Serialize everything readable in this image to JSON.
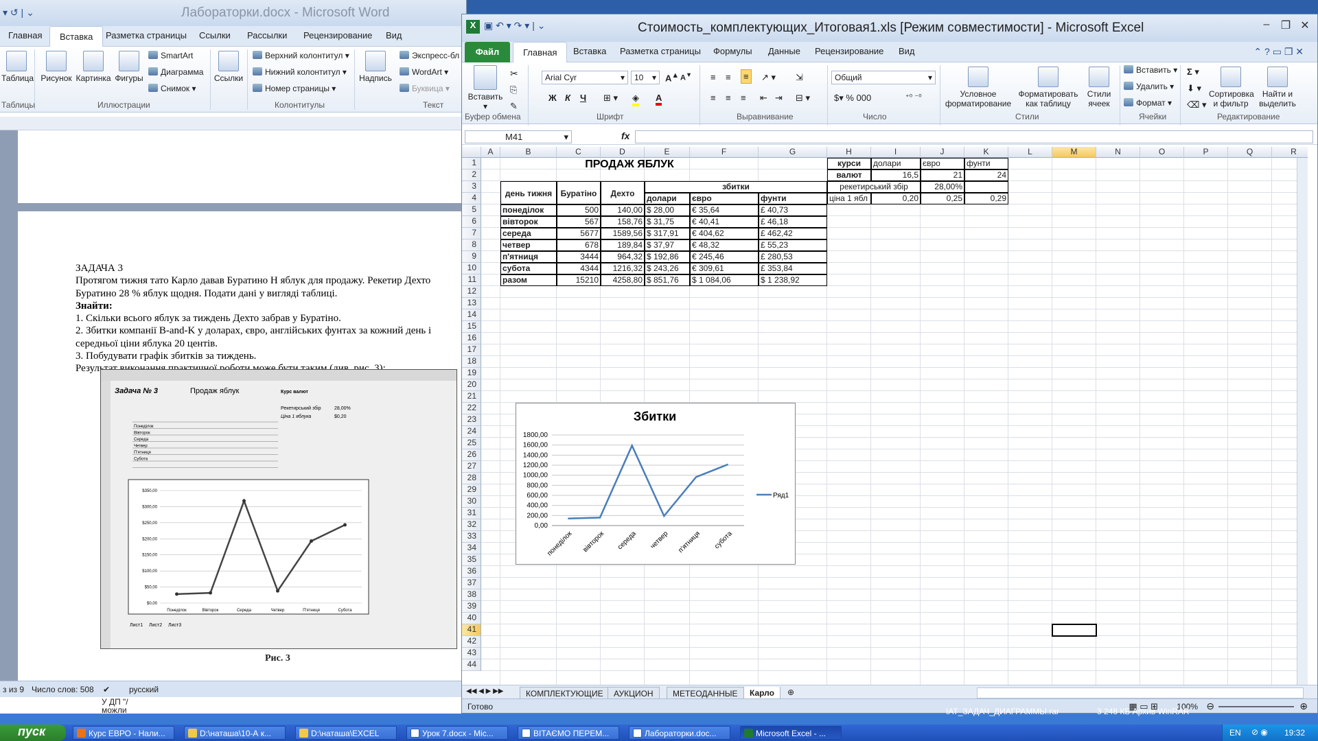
{
  "word": {
    "title": "Лабораторки.docx  -  Microsoft Word",
    "tabs": [
      "Главная",
      "Вставка",
      "Разметка страницы",
      "Ссылки",
      "Рассылки",
      "Рецензирование",
      "Вид"
    ],
    "active_tab": "Вставка",
    "ribbon": {
      "table": "Таблица",
      "picture": "Рисунок",
      "clipart": "Картинка",
      "shapes": "Фигуры",
      "smartart": "SmartArt",
      "chart": "Диаграмма",
      "snapshot": "Снимок",
      "links": "Ссылки",
      "header": "Верхний колонтитул",
      "footer": "Нижний колонтитул",
      "page_number": "Номер страницы",
      "textbox": "Надпись",
      "express": "Экспресс-бл",
      "wordart": "WordArt",
      "dropcap": "Буквица",
      "groups": [
        "Таблицы",
        "Иллюстрации",
        "Колонтитулы",
        "Текст"
      ]
    },
    "doc": {
      "heading": "ЗАДАЧА 3",
      "p1": "Протягом тижня тато Карло давав Буратино Н яблук для продажу. Рекетир Дехто",
      "p1b": "Буратино 28 % яблук щодня. Подати дані у вигляді таблиці.",
      "find": "Знайти:",
      "l1": "1. Скільки всього яблук за тиждень Дехто забрав у Буратіно.",
      "l2": "2. Збитки компанії B-and-K у доларах, євро, англійських фунтах за кожний день і",
      "l2b": "середньої ціни яблука 20 центів.",
      "l3": "3. Побудувати графік збитків за тиждень.",
      "l4": "Результат виконання практичної роботи може бути таким (див. рис. 3):",
      "caption": "Рис. 3",
      "fig": {
        "title1": "Задача № 3",
        "title2": "Продаж яблук",
        "kurs": "Курс валют",
        "reket": "Рекетирський збір",
        "reket_val": "28,00%",
        "price": "Ціна 1 яблука",
        "price_val": "$0,20",
        "days": [
          "Понеділок",
          "Вівторок",
          "Середа",
          "Четвер",
          "П'ятниця",
          "Субота"
        ],
        "yticks": [
          "$0,00",
          "$50,00",
          "$100,00",
          "$150,00",
          "$200,00",
          "$250,00",
          "$300,00",
          "$350,00"
        ],
        "values": [
          28,
          31.75,
          317.91,
          37.97,
          192.86,
          243.26
        ],
        "sheets": [
          "Лист1",
          "Лист2",
          "Лист3"
        ]
      }
    },
    "status": {
      "page": "з из 9",
      "words": "Число слов: 508",
      "lang": "русский"
    },
    "below1": "У ДП \"/",
    "below2": "можли"
  },
  "excel": {
    "title": "Стоимость_комплектующих_Итоговая1.xls  [Режим совместимости]  -  Microsoft Excel",
    "file_tab": "Файл",
    "tabs": [
      "Главная",
      "Вставка",
      "Разметка страницы",
      "Формулы",
      "Данные",
      "Рецензирование",
      "Вид"
    ],
    "active_tab": "Главная",
    "ribbon": {
      "paste": "Вставить",
      "font_name": "Arial Cyr",
      "font_size": "10",
      "number_format": "Общий",
      "cond_format": "Условное форматирование",
      "format_table": "Форматировать как таблицу",
      "cell_styles": "Стили ячеек",
      "insert": "Вставить",
      "delete": "Удалить",
      "format": "Формат",
      "sort": "Сортировка и фильтр",
      "find": "Найти и выделить",
      "groups": [
        "Буфер обмена",
        "Шрифт",
        "Выравнивание",
        "Число",
        "Стили",
        "Ячейки",
        "Редактирование"
      ]
    },
    "name_box": "M41",
    "fx": "fx",
    "columns": [
      "A",
      "B",
      "C",
      "D",
      "E",
      "F",
      "G",
      "H",
      "I",
      "J",
      "K",
      "L",
      "M",
      "N",
      "O",
      "P",
      "Q",
      "R"
    ],
    "sheet": {
      "title": "ПРОДАЖ ЯБЛУК",
      "header_day": "день тижня",
      "header_buratino": "Буратіно",
      "header_dehto": "Дехто",
      "header_losses": "збитки",
      "header_usd": "долари",
      "header_eur": "євро",
      "header_gbp": "фунти",
      "rows": [
        {
          "day": "понеділок",
          "b": "500",
          "d": "140,00",
          "usd": "$   28,00",
          "eur": "€          35,64",
          "gbp": "£          40,73"
        },
        {
          "day": "вівторок",
          "b": "567",
          "d": "158,76",
          "usd": "$   31,75",
          "eur": "€          40,41",
          "gbp": "£          46,18"
        },
        {
          "day": "середа",
          "b": "5677",
          "d": "1589,56",
          "usd": "$ 317,91",
          "eur": "€        404,62",
          "gbp": "£        462,42"
        },
        {
          "day": "четвер",
          "b": "678",
          "d": "189,84",
          "usd": "$   37,97",
          "eur": "€          48,32",
          "gbp": "£          55,23"
        },
        {
          "day": "п'ятниця",
          "b": "3444",
          "d": "964,32",
          "usd": "$ 192,86",
          "eur": "€        245,46",
          "gbp": "£        280,53"
        },
        {
          "day": "субота",
          "b": "4344",
          "d": "1216,32",
          "usd": "$ 243,26",
          "eur": "€        309,61",
          "gbp": "£        353,84"
        },
        {
          "day": "разом",
          "b": "15210",
          "d": "4258,80",
          "usd": "$ 851,76",
          "eur": "$      1 084,06",
          "gbp": "$      1 238,92"
        }
      ],
      "rates": {
        "kurs1": "курси",
        "kurs2": "валют",
        "usd": "долари",
        "eur": "євро",
        "gbp": "фунти",
        "usd_val": "16,5",
        "eur_val": "21",
        "gbp_val": "24",
        "reket": "рекетирський збір",
        "reket_val": "28,00%",
        "price": "ціна 1 ябл",
        "price_usd": "0,20",
        "price_eur": "0,25",
        "price_gbp": "0,29"
      }
    },
    "chart_data": {
      "type": "line",
      "title": "Збитки",
      "categories": [
        "понеділок",
        "вівторок",
        "середа",
        "четвер",
        "п'ятниця",
        "субота"
      ],
      "series": [
        {
          "name": "Ряд1",
          "values": [
            140,
            158.76,
            1589.56,
            189.84,
            964.32,
            1216.32
          ]
        }
      ],
      "ylim": [
        0,
        1800
      ],
      "yticks": [
        "0,00",
        "200,00",
        "400,00",
        "600,00",
        "800,00",
        "1000,00",
        "1200,00",
        "1400,00",
        "1600,00",
        "1800,00"
      ],
      "grid": true,
      "legend": "right",
      "color": "#4a7ebb"
    },
    "sheet_tabs": [
      "КОМПЛЕКТУЮЩИЕ",
      "АУКЦИОН",
      "МЕТЕОДАННЫЕ",
      "Карло"
    ],
    "active_sheet": "Карло",
    "status": {
      "ready": "Готово",
      "zoom": "100%"
    }
  },
  "taskbar": {
    "start": "пуск",
    "tasks": [
      "Курс ЕВРО - Нали...",
      "D:\\наташа\\10-А к...",
      "D:\\наташа\\EXCEL",
      "Урок 7.docx - Mic...",
      "ВІТАЄМО ПЕРЕМ...",
      "Лабораторки.doc...",
      "Microsoft Excel - ..."
    ],
    "lang": "EN",
    "clock": "19:32",
    "behind_text": "IAT_ЗАДАЧ_ДИАГРАММЫ.rar",
    "behind_size": "3 248 КБ  Архив WinRAR"
  }
}
